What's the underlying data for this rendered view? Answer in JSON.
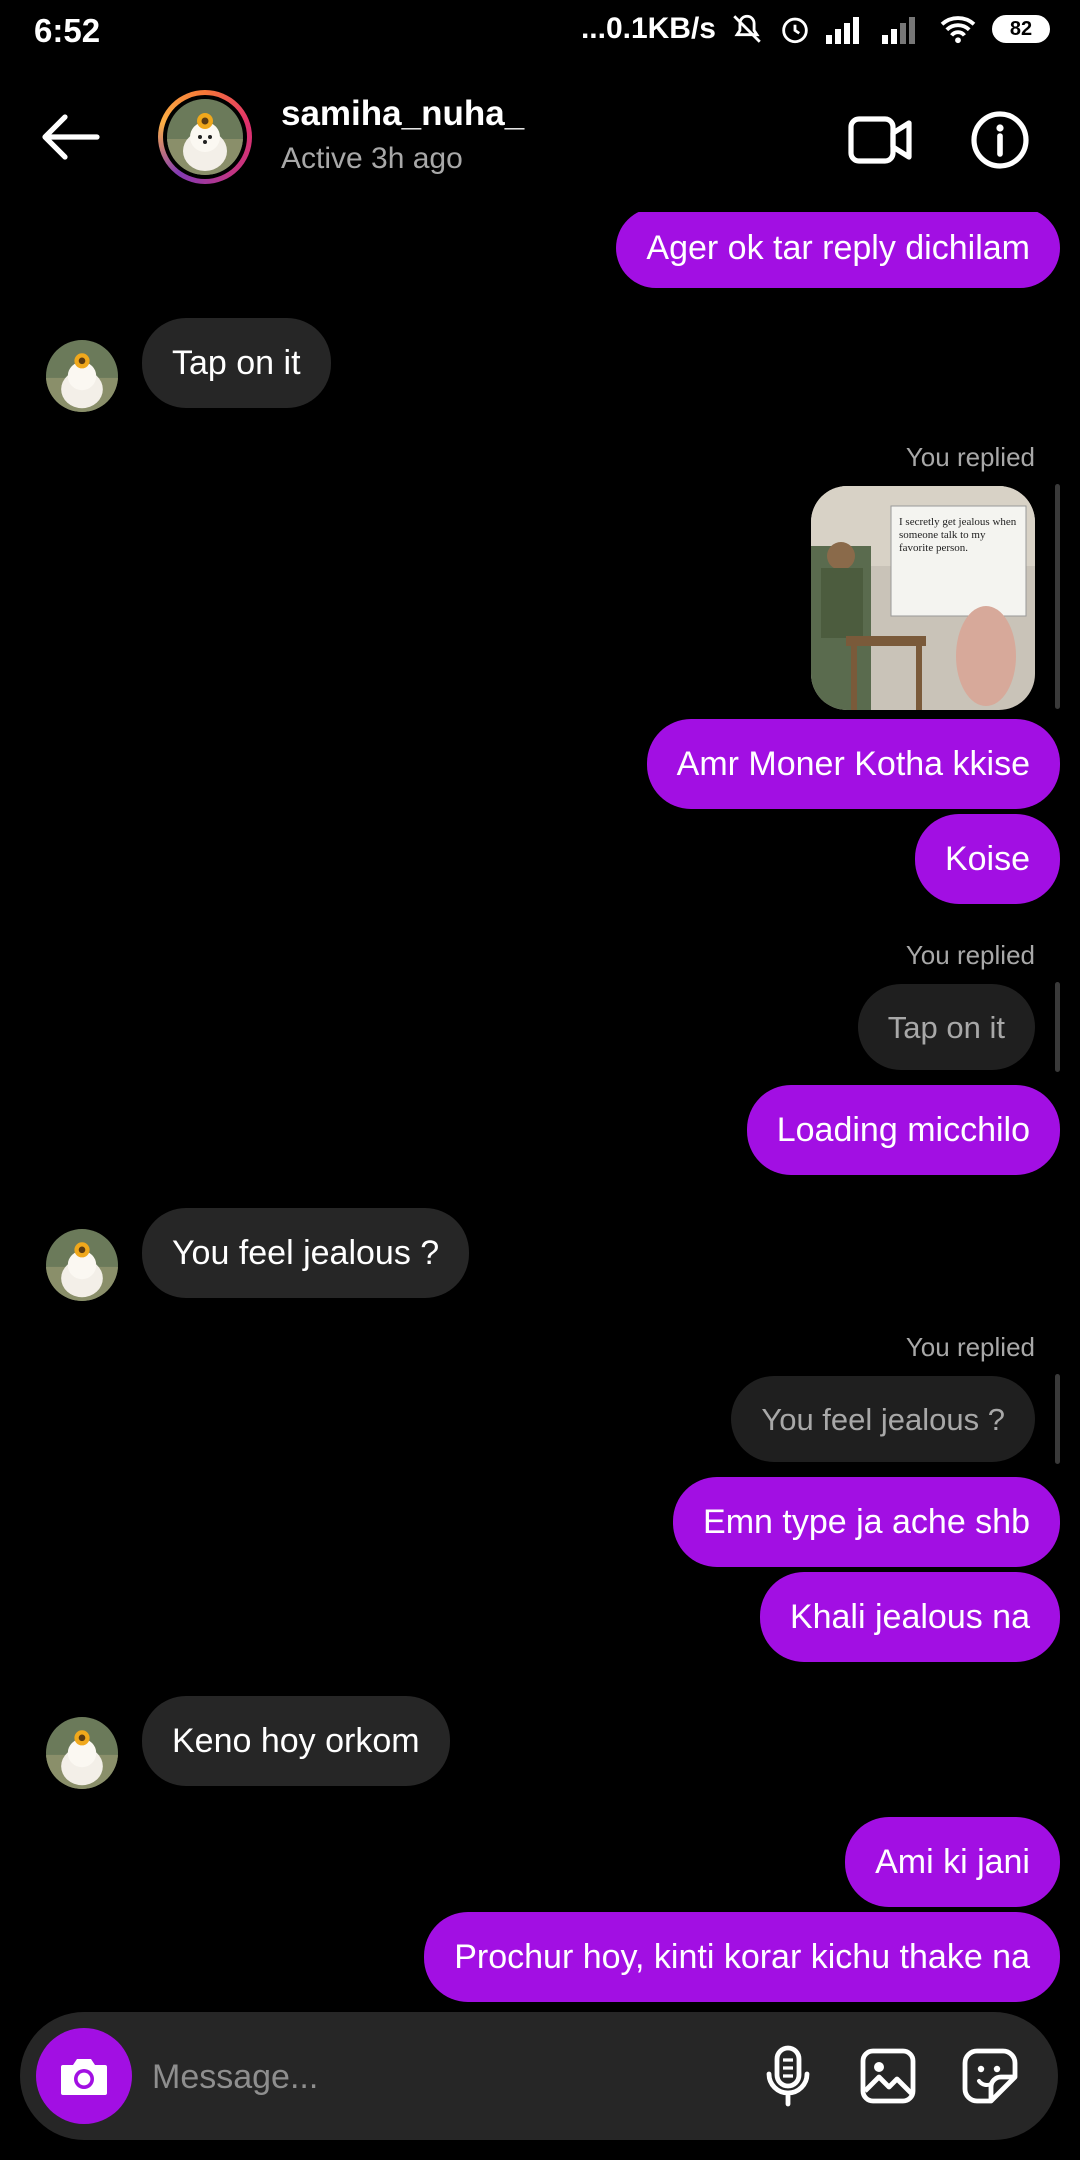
{
  "status_bar": {
    "time": "6:52",
    "speed": "...0.1KB/s",
    "battery": "82"
  },
  "header": {
    "username": "samiha_nuha_",
    "status": "Active 3h ago",
    "back_icon": "arrow-left-icon",
    "video_icon": "video-camera-icon",
    "info_icon": "info-icon"
  },
  "messages": {
    "m1": "Ager ok tar reply dichilam",
    "m2": "Tap on it",
    "reply1_label": "You replied",
    "reply1_image_caption": "I secretly get jealous when someone talk to my favorite person.",
    "m3": "Amr Moner Kotha kkise",
    "m4": "Koise",
    "reply2_label": "You replied",
    "reply2_quote": "Tap on it",
    "m5": "Loading micchilo",
    "m6": "You feel jealous ?",
    "reply3_label": "You replied",
    "reply3_quote": "You feel jealous ?",
    "m7": "Emn type ja ache shb",
    "m8": "Khali jealous na",
    "m9": "Keno hoy orkom",
    "m10": "Ami ki jani",
    "m11": "Prochur hoy, kinti korar kichu thake na"
  },
  "composer": {
    "placeholder": "Message...",
    "camera_icon": "camera-icon",
    "mic_icon": "microphone-icon",
    "gallery_icon": "image-icon",
    "sticker_icon": "sticker-icon"
  },
  "colors": {
    "accent": "#a20fe3",
    "incoming_bubble": "#262626",
    "background": "#000000"
  }
}
